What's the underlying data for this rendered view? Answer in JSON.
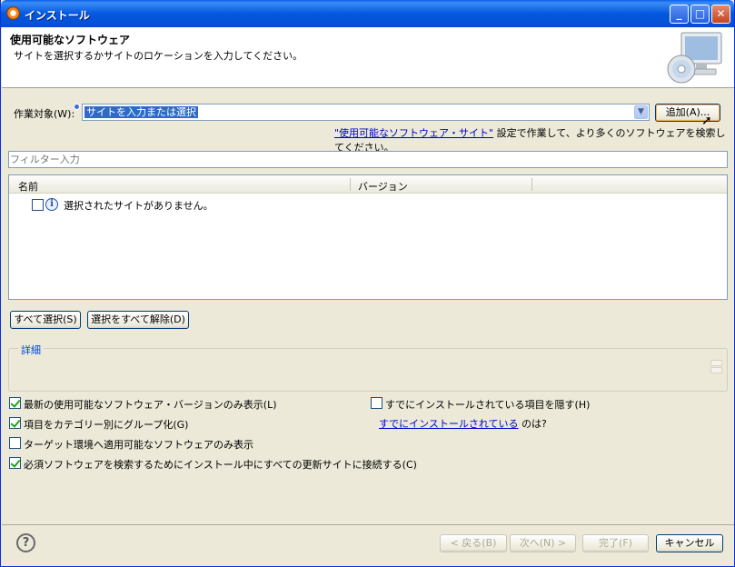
{
  "window": {
    "title": "インストール"
  },
  "banner": {
    "title": "使用可能なソフトウェア",
    "description": "サイトを選択するかサイトのロケーションを入力してください。"
  },
  "work_with": {
    "label": "作業対象(W):",
    "value": "サイトを入力または選択",
    "add_button": "追加(A)...",
    "link_text": "\"使用可能なソフトウェア・サイト\"",
    "link_suffix": "設定で作業して、より多くのソフトウェアを検索してください。"
  },
  "filter": {
    "placeholder": "フィルター入力"
  },
  "tree": {
    "columns": [
      "名前",
      "バージョン"
    ],
    "rows": [
      {
        "label": "選択されたサイトがありません。",
        "checked": false
      }
    ]
  },
  "selection_buttons": {
    "select_all": "すべて選択(S)",
    "deselect_all": "選択をすべて解除(D)"
  },
  "details": {
    "title": "詳細"
  },
  "options": {
    "latest_only": {
      "label": "最新の使用可能なソフトウェア・バージョンのみ表示(L)",
      "checked": true
    },
    "group_by_category": {
      "label": "項目をカテゴリー別にグループ化(G)",
      "checked": true
    },
    "target_env_only": {
      "label": "ターゲット環境へ適用可能なソフトウェアのみ表示",
      "checked": false
    },
    "contact_all_sites": {
      "label": "必須ソフトウェアを検索するためにインストール中にすべての更新サイトに接続する(C)",
      "checked": true
    },
    "hide_installed": {
      "label": "すでにインストールされている項目を隠す(H)",
      "checked": false
    },
    "already_installed_link": "すでにインストールされている",
    "already_installed_suffix": "のは?"
  },
  "footer": {
    "back": "< 戻る(B)",
    "next": "次へ(N) >",
    "finish": "完了(F)",
    "cancel": "キャンセル"
  },
  "icons": {
    "app": "eclipse-icon",
    "help": "help-icon",
    "info": "info-icon",
    "banner": "install-software-icon"
  },
  "colors": {
    "titlebar": "#0458e0",
    "dialog_bg": "#ece9d8",
    "link": "#0000cc",
    "selection": "#316ac5"
  }
}
